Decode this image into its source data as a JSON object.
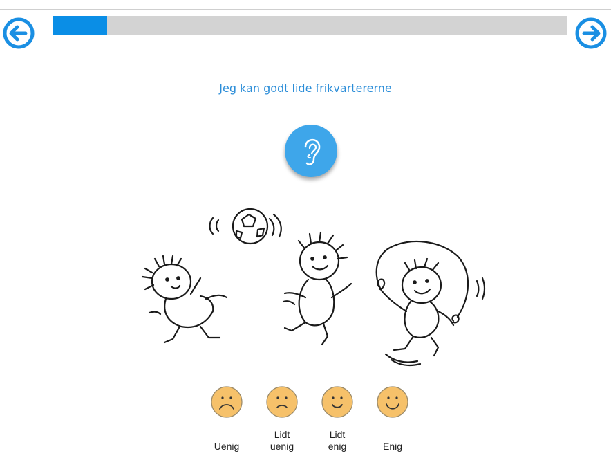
{
  "progress": {
    "value_fraction": 0.105
  },
  "question": {
    "text": "Jeg kan godt lide frikvartererne"
  },
  "nav": {
    "back_icon": "arrow-left-circle-icon",
    "forward_icon": "arrow-right-circle-icon"
  },
  "audio": {
    "icon": "ear-icon"
  },
  "colors": {
    "accent": "#0a8ee6",
    "question_text": "#2b8dd8",
    "audio_button": "#3ea6ea",
    "face_fill": "#f6c16a",
    "progress_track": "#d3d3d3"
  },
  "answers": [
    {
      "label_line1": "",
      "label_line2": "Uenig",
      "face": "frown-face-icon"
    },
    {
      "label_line1": "Lidt",
      "label_line2": "uenig",
      "face": "slight-frown-face-icon"
    },
    {
      "label_line1": "Lidt",
      "label_line2": "enig",
      "face": "slight-smile-face-icon"
    },
    {
      "label_line1": "",
      "label_line2": "Enig",
      "face": "smile-face-icon"
    }
  ]
}
